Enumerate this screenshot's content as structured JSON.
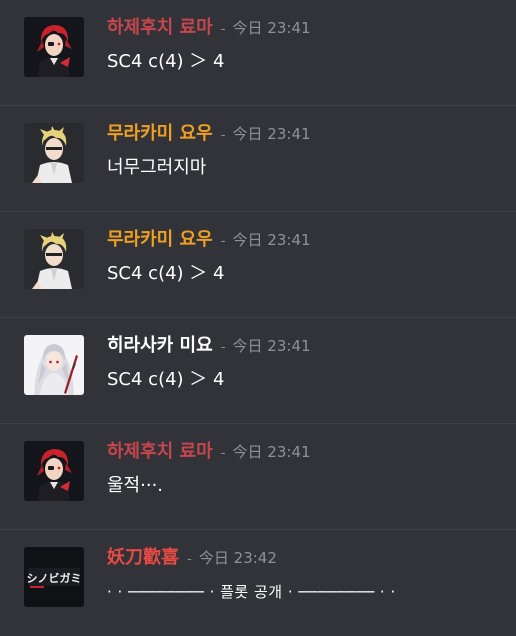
{
  "colors": {
    "background": "#323339",
    "divider": "#3f4147",
    "username_red": "#c7454d",
    "username_orange": "#f0a020",
    "username_white": "#ffffff",
    "username_bright_red": "#e84a44",
    "timestamp": "#8e9297",
    "message_text": "#ffffff"
  },
  "messages": [
    {
      "username": "하제후치 료마",
      "separator": "-",
      "timestamp": "今日 23:41",
      "text": "SC4 c(4) ＞ 4",
      "avatar_icon": "red-haired-character-avatar-icon"
    },
    {
      "username": "무라카미 요우",
      "separator": "-",
      "timestamp": "今日 23:41",
      "text": "너무그러지마",
      "avatar_icon": "blonde-character-avatar-icon"
    },
    {
      "username": "무라카미 요우",
      "separator": "-",
      "timestamp": "今日 23:41",
      "text": "SC4 c(4) ＞ 4",
      "avatar_icon": "blonde-character-avatar-icon"
    },
    {
      "username": "히라사카 미요",
      "separator": "-",
      "timestamp": "今日 23:41",
      "text": "SC4 c(4) ＞ 4",
      "avatar_icon": "white-haired-character-avatar-icon"
    },
    {
      "username": "하제후치 료마",
      "separator": "-",
      "timestamp": "今日 23:41",
      "text": "울적···.",
      "avatar_icon": "red-haired-character-avatar-icon"
    },
    {
      "username": "妖刀歡喜",
      "separator": "-",
      "timestamp": "今日 23:42",
      "text": "· · ──────── · 플롯 공개 · ──────── · ·",
      "avatar_icon": "shinobigami-logo-avatar-icon",
      "avatar_logo_text": "シノビガミ"
    }
  ]
}
